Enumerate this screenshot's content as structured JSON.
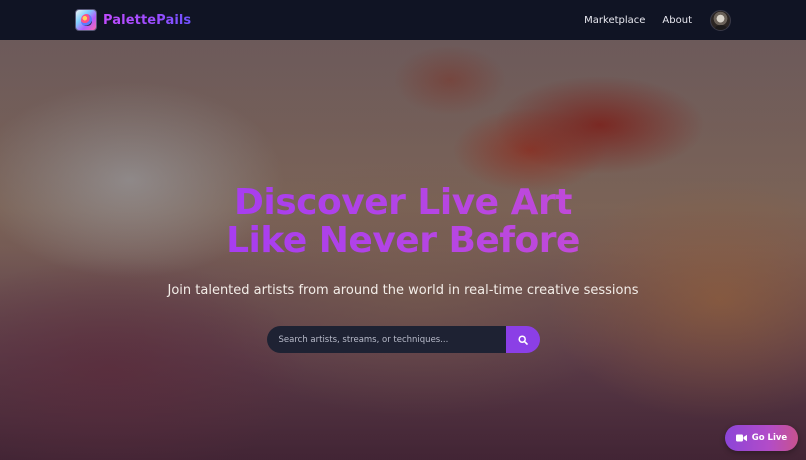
{
  "navbar": {
    "brand": "PalettePails",
    "links": [
      "Marketplace",
      "About"
    ],
    "logo_icon": "palette-logo-icon",
    "avatar_icon": "user-avatar"
  },
  "hero": {
    "title_line1": "Discover Live Art",
    "title_line2": "Like Never Before",
    "subtitle": "Join talented artists from around the world in real-time creative sessions",
    "search": {
      "placeholder": "Search artists, streams, or techniques...",
      "value": "",
      "button_icon": "search-icon"
    }
  },
  "go_live": {
    "label": "Go Live",
    "icon": "video-camera-icon"
  },
  "colors": {
    "navbar_bg": "#101424",
    "accent": "#8b3fe6",
    "title_gradient_start": "#a73df0",
    "title_gradient_end": "#c04ad8",
    "search_bg": "#1e2233"
  }
}
